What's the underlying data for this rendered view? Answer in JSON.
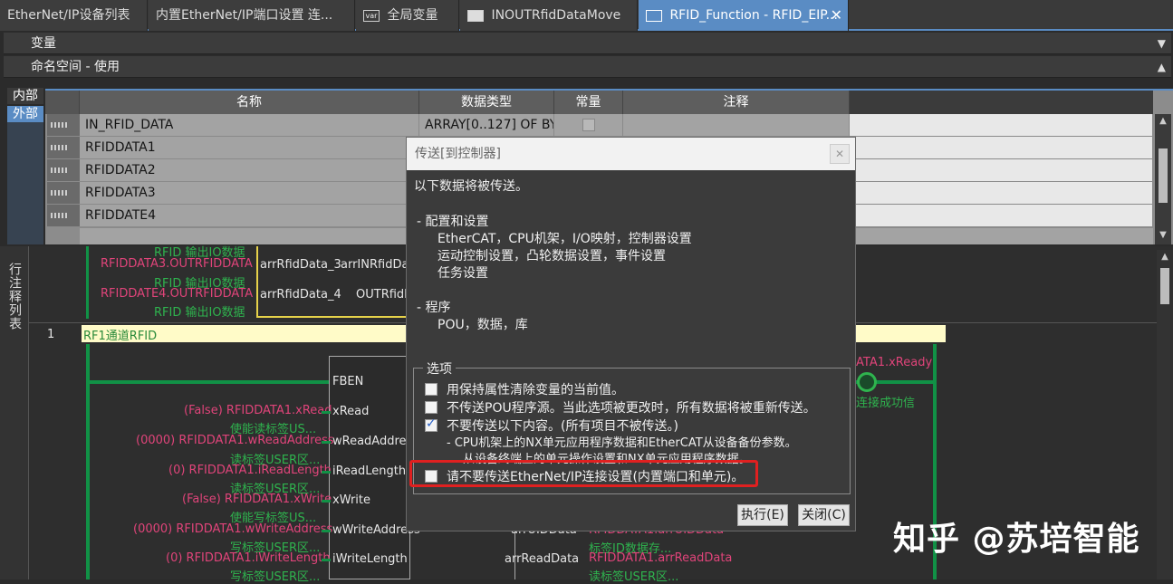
{
  "tabs": [
    {
      "label": "EtherNet/IP设备列表",
      "icon": ""
    },
    {
      "label": "内置EtherNet/IP端口设置 连...",
      "icon": ""
    },
    {
      "label": "全局变量",
      "icon": "var"
    },
    {
      "label": "INOUTRfidDataMove",
      "icon": "doc-icon"
    },
    {
      "label": "RFID_Function - RFID_EIP...",
      "icon": "function-icon"
    }
  ],
  "panels": {
    "variables": "变量",
    "namespace": "命名空间 - 使用"
  },
  "side_tabs": {
    "internal": "内部",
    "external": "外部"
  },
  "grid": {
    "headers": {
      "name": "名称",
      "type": "数据类型",
      "constant": "常量",
      "comment": "注释"
    },
    "rows": [
      {
        "name": "IN_RFID_DATA",
        "type": "ARRAY[0..127] OF BYT"
      },
      {
        "name": "RFIDDATA1",
        "type": ""
      },
      {
        "name": "RFIDDATA2",
        "type": ""
      },
      {
        "name": "RFIDDATA3",
        "type": ""
      },
      {
        "name": "RFIDDATE4",
        "type": ""
      }
    ]
  },
  "ladder": {
    "side_label": "行注释列表",
    "rung_number": "1",
    "rung_comment": "RF1通道RFID",
    "top_lines": {
      "l0": "RFID 输出IO数据",
      "l1_var": "RFIDDATA3.OUTRFIDDATA",
      "l1_pin": "arrRfidData_3",
      "l1_pin2": "arrINRfidDa",
      "l2": "RFID 输出IO数据",
      "l3_var": "RFIDDATE4.OUTRFIDDATA",
      "l3_pin": "arrRfidData_4",
      "l3_pin2": "OUTRfidD",
      "l4": "RFID 输出IO数据"
    },
    "fb_inputs": [
      {
        "var": "",
        "comment": "",
        "pin": "FBEN"
      },
      {
        "var": "(False) RFIDDATA1.xRead",
        "comment": "使能读标签US...",
        "pin": "xRead"
      },
      {
        "var": "(0000) RFIDDATA1.wReadAddress",
        "comment": "读标签USER区...",
        "pin": "wReadAddress"
      },
      {
        "var": "(0) RFIDDATA1.iReadLength",
        "comment": "读标签USER区...",
        "pin": "iReadLength"
      },
      {
        "var": "(False) RFIDDATA1.xWrite",
        "comment": "使能写标签US...",
        "pin": "xWrite"
      },
      {
        "var": "(0000) RFIDDATA1.wWriteAddress",
        "comment": "写标签USER区...",
        "pin": "wWriteAddress"
      },
      {
        "var": "(0) RFIDDATA1.iWriteLength",
        "comment": "写标签USER区...",
        "pin": "iWriteLength"
      }
    ],
    "fb_out_pin1": "arrUIDData",
    "fb_out_pin2": "arrReadData",
    "out1_var": "RFIDDATA1.arrUIDData",
    "out1_comment": "标签ID数据存...",
    "out2_var": "RFIDDATA1.arrReadData",
    "out2_comment": "读标签USER区...",
    "ready_var": "ATA1.xReady",
    "ready_comment": "连接成功信"
  },
  "dialog": {
    "title": "传送[到控制器]",
    "intro": "以下数据将被传送。",
    "config_header": "- 配置和设置",
    "config_line1": "EtherCAT，CPU机架，I/O映射，控制器设置",
    "config_line2": "运动控制设置，凸轮数据设置，事件设置",
    "config_line3": "任务设置",
    "program_header": "- 程序",
    "program_line1": "POU，数据，库",
    "options_label": "选项",
    "options": [
      {
        "label": "用保持属性清除变量的当前值。",
        "checked": false
      },
      {
        "label": "不传送POU程序源。当此选项被更改时，所有数据将被重新传送。",
        "checked": false
      },
      {
        "label": "不要传送以下内容。(所有项目不被传送。)",
        "checked": true
      }
    ],
    "sub_note1": "- CPU机架上的NX单元应用程序数据和EtherCAT从设备备份参数。",
    "sub_note2": "从设备终端上的单元操作设置和NX单元应用程序数据。",
    "option_highlighted": {
      "label": "请不要传送EtherNet/IP连接设置(内置端口和单元)。",
      "checked": false
    },
    "execute_button": "执行(E)",
    "close_button": "关闭(C)",
    "highlight_color": "#e02020"
  },
  "watermark": "知乎 @苏培智能",
  "colors": {
    "accent": "#5a8cc4",
    "rail": "#119146",
    "var_red": "#e0447a",
    "comment_green": "#2fb34e"
  }
}
